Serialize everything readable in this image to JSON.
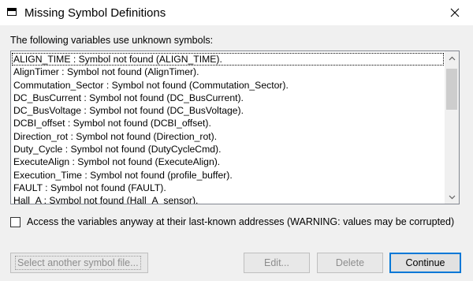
{
  "window": {
    "title": "Missing Symbol Definitions"
  },
  "prompt": "The following variables use unknown symbols:",
  "items": [
    "ALIGN_TIME : Symbol not found (ALIGN_TIME).",
    "AlignTimer : Symbol not found (AlignTimer).",
    "Commutation_Sector : Symbol not found (Commutation_Sector).",
    "DC_BusCurrent : Symbol not found (DC_BusCurrent).",
    "DC_BusVoltage : Symbol not found (DC_BusVoltage).",
    "DCBI_offset : Symbol not found (DCBI_offset).",
    "Direction_rot : Symbol not found (Direction_rot).",
    "Duty_Cycle : Symbol not found (DutyCycleCmd).",
    "ExecuteAlign : Symbol not found (ExecuteAlign).",
    "Execution_Time : Symbol not found (profile_buffer).",
    "FAULT : Symbol not found (FAULT).",
    "Hall_A : Symbol not found (Hall_A_sensor)."
  ],
  "checkbox": {
    "label": "Access the variables anyway at their last-known addresses (WARNING: values may be corrupted)",
    "checked": false
  },
  "buttons": {
    "select_symbol_file": "Select another symbol file...",
    "edit": "Edit...",
    "delete": "Delete",
    "continue": "Continue"
  },
  "icons": {
    "app": "window-icon",
    "close": "close-icon",
    "scroll_up": "chevron-up-icon",
    "scroll_down": "chevron-down-icon"
  },
  "colors": {
    "dialog_bg": "#f0f0f0",
    "default_button_border": "#0078d7",
    "disabled_text": "#8d8d8d"
  }
}
